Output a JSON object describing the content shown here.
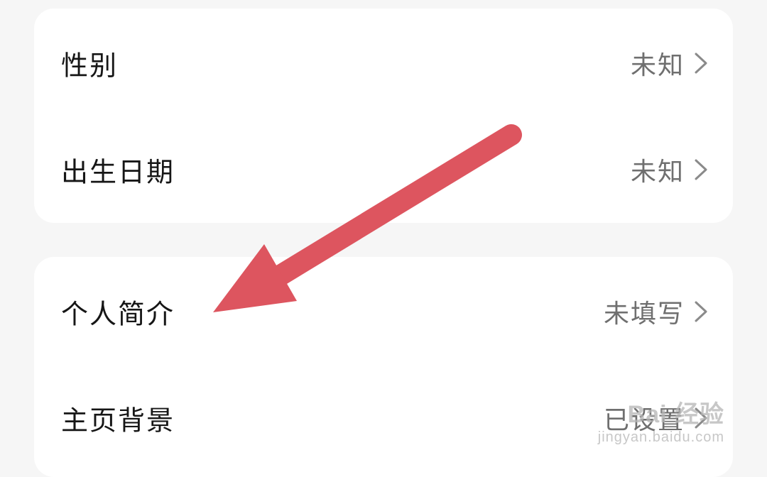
{
  "settings": {
    "group1": [
      {
        "label": "性别",
        "value": "未知"
      },
      {
        "label": "出生日期",
        "value": "未知"
      }
    ],
    "group2": [
      {
        "label": "个人简介",
        "value": "未填写"
      },
      {
        "label": "主页背景",
        "value": "已设置"
      }
    ]
  },
  "annotation": {
    "arrow_color": "#dd555f"
  },
  "watermark": {
    "logo_text": "Bai 经验",
    "url": "jingyan.baidu.com"
  },
  "icons": {
    "row_chevron": "chevron-right-icon"
  }
}
